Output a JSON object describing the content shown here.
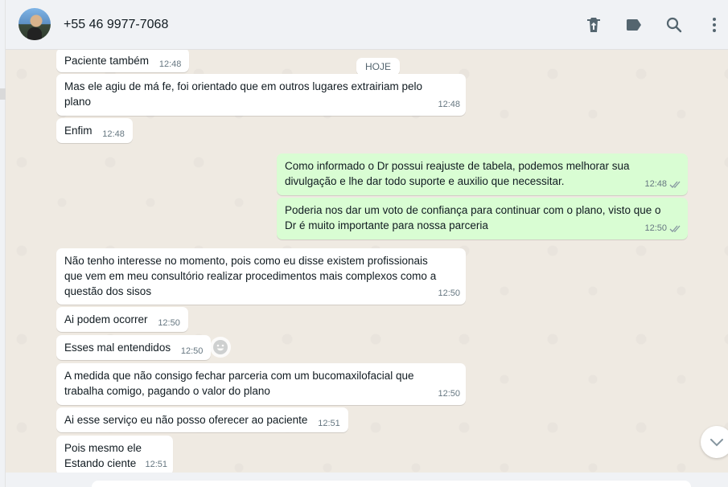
{
  "header": {
    "contact_name": "+55 46 9977-7068",
    "icons": [
      "delete-icon",
      "label-icon",
      "search-icon",
      "menu-icon"
    ]
  },
  "date_chip": "HOJE",
  "messages": [
    {
      "dir": "in",
      "text": "Paciente também",
      "time": "12:48"
    },
    {
      "dir": "in",
      "text": "Mas ele agiu de má fe, foi orientado que em outros lugares extrairiam pelo\nplano",
      "time": "12:48"
    },
    {
      "dir": "in",
      "text": "Enfim",
      "time": "12:48"
    },
    {
      "dir": "out",
      "text": "Como informado o Dr possui reajuste de tabela, podemos melhorar sua\ndivulgação e lhe dar todo suporte e auxilio que necessitar.",
      "time": "12:48"
    },
    {
      "dir": "out",
      "text": "Poderia nos dar um voto de confiança para continuar com o plano, visto que o\nDr é muito importante para nossa parceria",
      "time": "12:50"
    },
    {
      "dir": "in",
      "text": "Não tenho interesse no momento, pois como eu disse existem profissionais\nque vem em meu consultório realizar procedimentos mais complexos como a\nquestão dos sisos",
      "time": "12:50"
    },
    {
      "dir": "in",
      "text": "Ai podem ocorrer",
      "time": "12:50"
    },
    {
      "dir": "in",
      "text": "Esses mal entendidos",
      "time": "12:50"
    },
    {
      "dir": "in",
      "text": "A medida que não consigo fechar parceria com um bucomaxilofacial que\ntrabalha comigo, pagando o valor do plano",
      "time": "12:50"
    },
    {
      "dir": "in",
      "text": "Ai esse serviço eu não posso oferecer ao paciente",
      "time": "12:51"
    },
    {
      "dir": "in",
      "text": "Pois mesmo ele\n Estando ciente",
      "time": "12:51"
    }
  ],
  "colors": {
    "incoming_bubble": "#ffffff",
    "outgoing_bubble": "#d9fdd3",
    "chat_background": "#efeae2",
    "read_ticks": "#8696a0"
  }
}
